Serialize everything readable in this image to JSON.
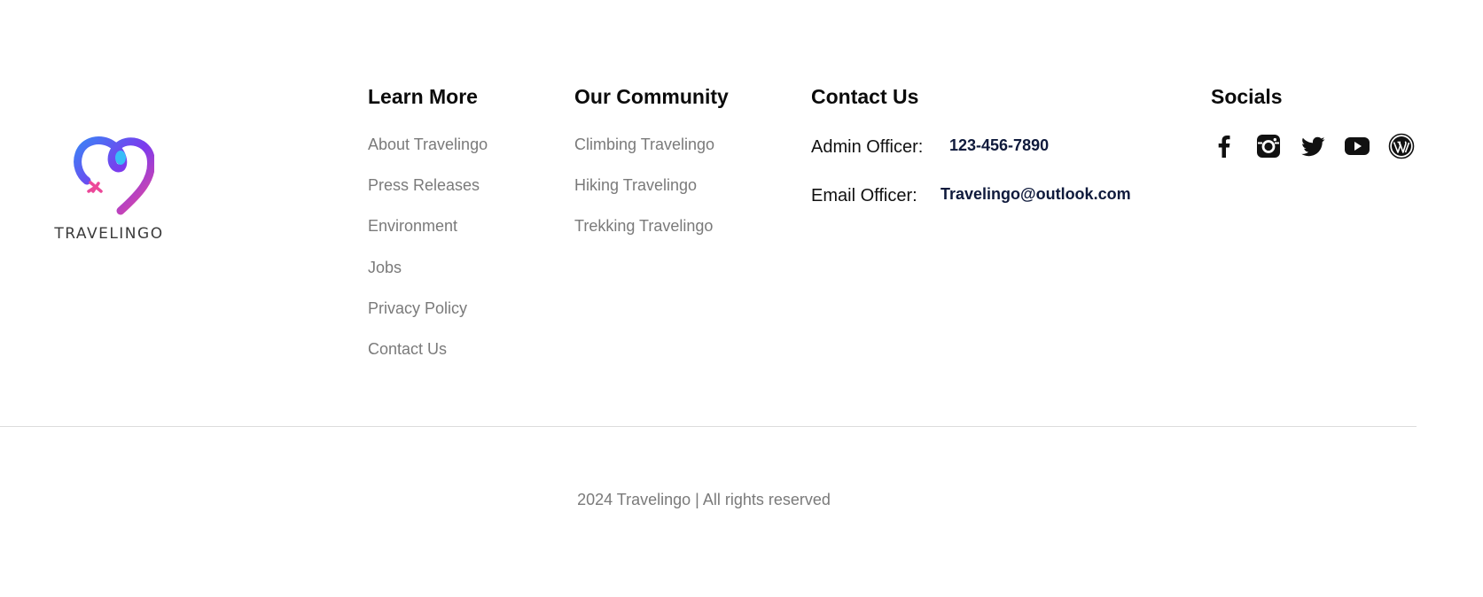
{
  "brand": {
    "name": "TRAVELINGO"
  },
  "learn_more": {
    "heading": "Learn More",
    "links": [
      "About Travelingo",
      "Press Releases",
      "Environment",
      "Jobs",
      "Privacy Policy",
      "Contact Us"
    ]
  },
  "community": {
    "heading": "Our Community",
    "links": [
      "Climbing Travelingo",
      "Hiking Travelingo",
      "Trekking Travelingo"
    ]
  },
  "contact": {
    "heading": "Contact Us",
    "admin_label": "Admin Officer:",
    "admin_phone": "123-456-7890",
    "email_label": "Email Officer:",
    "email": "Travelingo@outlook.com"
  },
  "socials": {
    "heading": "Socials",
    "icons": [
      "facebook-icon",
      "instagram-icon",
      "twitter-icon",
      "youtube-icon",
      "wordpress-icon"
    ]
  },
  "footer": {
    "copyright": "2024 Travelingo | All rights reserved"
  },
  "colors": {
    "heading": "#0b0b0b",
    "link": "#7a7a7a",
    "contact_value": "#0f1a3c",
    "logo_gradient_start": "#3b82f6",
    "logo_gradient_mid": "#7c3aed",
    "logo_gradient_end": "#ec4899"
  }
}
